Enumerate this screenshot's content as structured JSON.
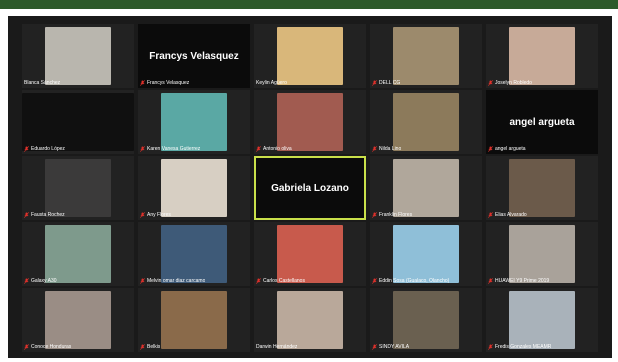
{
  "theme": {
    "topbar": "#2d5a2a",
    "background": "#1a1a1a",
    "active_speaker": "#c9e04a",
    "muted_mic": "#e0312b"
  },
  "participants": [
    {
      "name": "Blanca Sánchez",
      "video": true,
      "muted": false,
      "tone": "#b9b6ae"
    },
    {
      "name": "Francys Velasquez",
      "video": false,
      "muted": true
    },
    {
      "name": "Keylin Agüero",
      "video": true,
      "muted": false,
      "tone": "#d9b77a"
    },
    {
      "name": "DELL CG",
      "video": true,
      "muted": true,
      "tone": "#9c8a6c"
    },
    {
      "name": "Joselyn Robledo",
      "video": true,
      "muted": true,
      "tone": "#c7aa98"
    },
    {
      "name": "Eduardo López",
      "video": true,
      "muted": true,
      "tone": "#101010"
    },
    {
      "name": "Karen Vanesa Gutierrez",
      "video": true,
      "muted": true,
      "tone": "#5aa8a4"
    },
    {
      "name": "Antonio oliva",
      "video": true,
      "muted": true,
      "tone": "#a15b50"
    },
    {
      "name": "Nilda Lino",
      "video": true,
      "muted": true,
      "tone": "#8c7a5b"
    },
    {
      "name": "angel argueta",
      "video": false,
      "muted": true
    },
    {
      "name": "Fausta Rochez",
      "video": true,
      "muted": true,
      "tone": "#3b3a3a"
    },
    {
      "name": "Any Flores",
      "video": true,
      "muted": true,
      "tone": "#d7cfc3"
    },
    {
      "name": "Gabriela Lozano",
      "video": false,
      "muted": false,
      "active": true
    },
    {
      "name": "Franklin Flores",
      "video": true,
      "muted": true,
      "tone": "#b0a79b"
    },
    {
      "name": "Elias Alvarado",
      "video": true,
      "muted": true,
      "tone": "#6b5a4a"
    },
    {
      "name": "Galaxy A30",
      "video": true,
      "muted": true,
      "tone": "#7e9a8c"
    },
    {
      "name": "Melvin omar diaz carcamo",
      "video": true,
      "muted": true,
      "tone": "#3e5a78"
    },
    {
      "name": "Carlos Castellanos",
      "video": true,
      "muted": true,
      "tone": "#c85a4c"
    },
    {
      "name": "Eddin Sosa (Gualaco, Olancho)",
      "video": true,
      "muted": true,
      "tone": "#8fbfd8"
    },
    {
      "name": "HUAWEI Y9 Prime 2019",
      "video": true,
      "muted": true,
      "tone": "#a9a29a"
    },
    {
      "name": "Conoce Honduras",
      "video": true,
      "muted": true,
      "tone": "#9a8d85"
    },
    {
      "name": "Belkis",
      "video": true,
      "muted": true,
      "tone": "#8a6a4a"
    },
    {
      "name": "Darwin Hernández",
      "video": true,
      "muted": false,
      "tone": "#b9a89a"
    },
    {
      "name": "SINDY AVILA",
      "video": true,
      "muted": true,
      "tone": "#6a6050"
    },
    {
      "name": "Fredis Gonzales MEAMR",
      "video": true,
      "muted": true,
      "tone": "#a9b2ba"
    }
  ]
}
